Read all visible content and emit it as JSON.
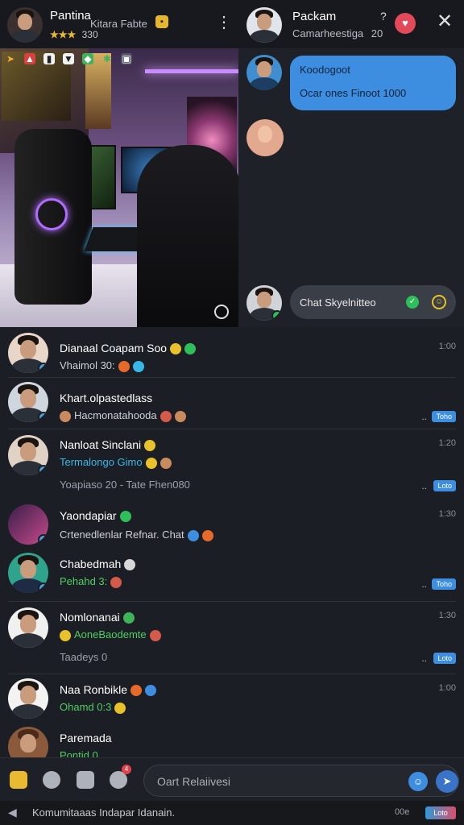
{
  "stream_header": {
    "name": "Pantina",
    "subtitle": "Kitara Fabte",
    "meta_stars": "★★★",
    "meta_value": "330"
  },
  "chat_header": {
    "name": "Packam",
    "subtitle": "Camarheestiga",
    "subtitle_count": "20",
    "help_label": "?"
  },
  "chat": {
    "messages": [
      {
        "line1": "Koodogoot",
        "line2": "Ocar ones Finoot 1000"
      }
    ],
    "input_pill": "Chat Skyelnitteo"
  },
  "conversations": [
    {
      "title": "Dianaal Coapam Soo",
      "line2": "Vhaimol 30:",
      "time": "1:00",
      "line2_color": "#c9ccd3"
    },
    {
      "title": "Khart.olpastedlass",
      "line2": "Hacmonatahooda",
      "time": "",
      "badge": "Toho"
    },
    {
      "title": "Nanloat Sinclani",
      "line2": "Termalongo Gimo",
      "line3": "Yoapiaso 20 - Tate Fhen080",
      "time": "1:20",
      "badge": "Loto",
      "line2_color": "#38b8e8"
    },
    {
      "title": "Yaondapiar",
      "line2": "Crtenedlenlar Refnar. Chat",
      "time": "1:30",
      "line2_color": "#c9ccd3"
    },
    {
      "title": "Chabedmah",
      "line2": "Pehahd 3:",
      "time": "",
      "badge": "Toho",
      "line2_color": "#4fcf62"
    },
    {
      "title": "Nomlonanai",
      "line2": "AoneBaodemte",
      "line3": "Taadeys 0",
      "time": "1:30",
      "badge": "Loto",
      "line2_color": "#4fcf62"
    },
    {
      "title": "Naa Ronbikle",
      "line2": "Ohamd 0:3",
      "time": "1:00",
      "line2_color": "#4fcf62"
    },
    {
      "title": "Paremada",
      "line2": "Pontid 0",
      "time": "",
      "line2_color": "#4fcf62"
    }
  ],
  "composer": {
    "placeholder": "Oart Relaiivesi",
    "notification_count": "4"
  },
  "footer": {
    "text": "Komumitaaas Indapar Idanain.",
    "count": "00e",
    "tag": "Loto"
  },
  "colors": {
    "accent": "#3d8ee0",
    "heart": "#e24a5a",
    "online": "#2fbf5a"
  }
}
